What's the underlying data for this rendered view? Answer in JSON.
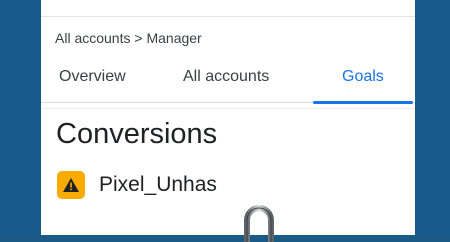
{
  "breadcrumb": {
    "root": "All accounts",
    "separator": ">",
    "current": "Manager"
  },
  "tabs": [
    {
      "label": "Overview",
      "active": false
    },
    {
      "label": "All accounts",
      "active": false
    },
    {
      "label": "Goals",
      "active": true
    }
  ],
  "page": {
    "title": "Conversions"
  },
  "account": {
    "name": "Pixel_Unhas",
    "status_icon": "warning-icon"
  },
  "overlay": {
    "icon": "padlock-icon"
  },
  "colors": {
    "accent": "#1a73e8",
    "warning": "#f9ab00",
    "background": "#175b8c"
  }
}
